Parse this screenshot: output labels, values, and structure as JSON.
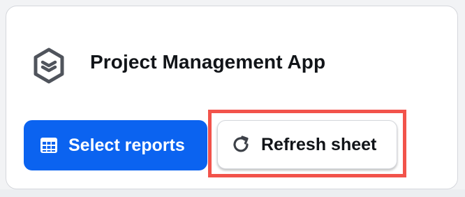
{
  "app": {
    "title": "Project Management App",
    "icon": "layers-hexagon-icon"
  },
  "actions": {
    "select_reports": {
      "label": "Select reports",
      "icon": "table-grid-icon",
      "color": "#0b63f0"
    },
    "refresh_sheet": {
      "label": "Refresh sheet",
      "icon": "refresh-icon",
      "highlight_color": "#f2534b"
    }
  }
}
